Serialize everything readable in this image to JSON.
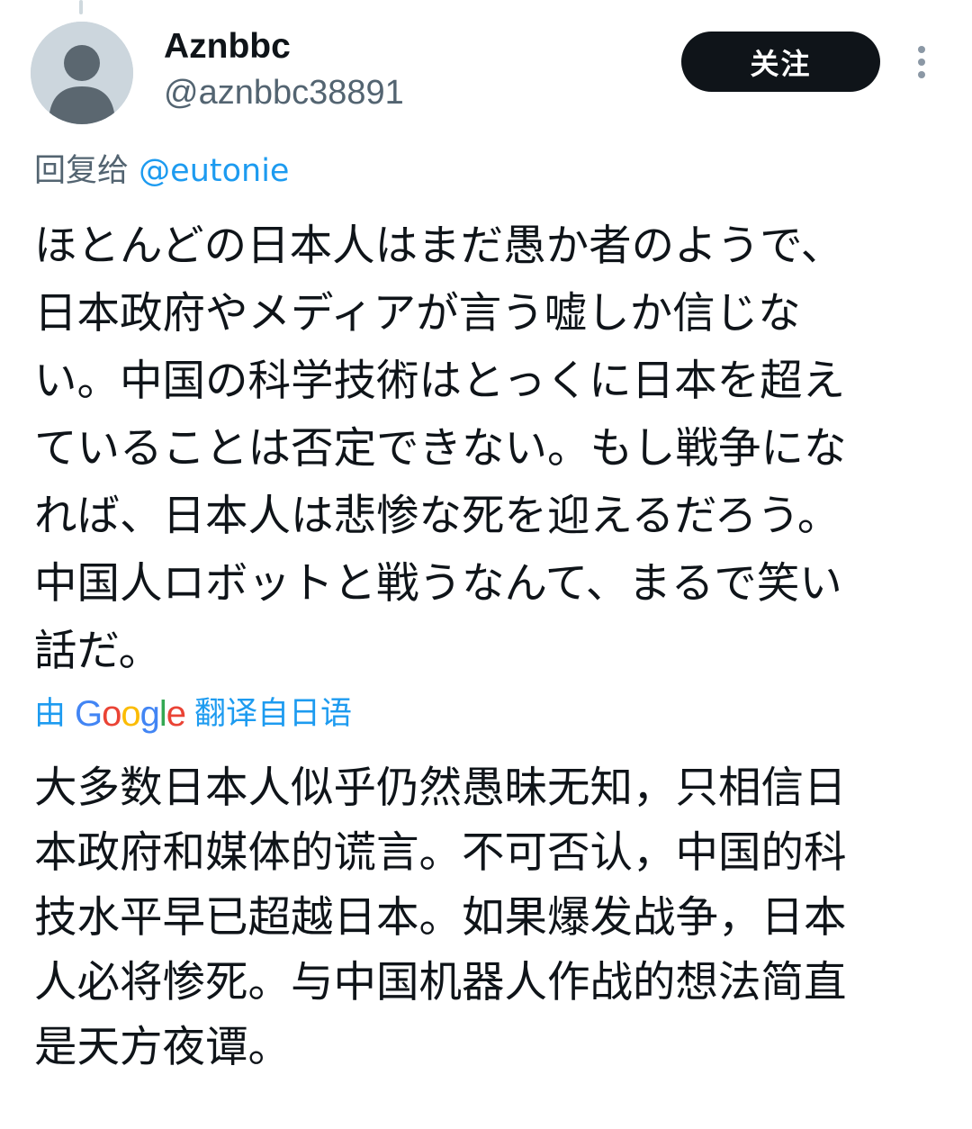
{
  "author": {
    "display_name": "Aznbbc",
    "handle": "@aznbbc38891",
    "avatar_icon": "default-avatar-icon"
  },
  "actions": {
    "follow_label": "关注",
    "more_icon": "more-vertical-icon"
  },
  "reply": {
    "prefix": "回复给",
    "mention": "@eutonie"
  },
  "tweet": {
    "text": "ほとんどの日本人はまだ愚か者のようで、\n日本政府やメディアが言う嘘しか信じな\nい。中国の科学技術はとっくに日本を超え\nていることは否定できない。もし戦争にな\nれば、日本人は悲惨な死を迎えるだろう。\n中国人ロボットと戦うなんて、まるで笑い\n話だ。"
  },
  "translation": {
    "prefix": "由",
    "provider": "Google",
    "suffix": "翻译自日语",
    "text": "大多数日本人似乎仍然愚昧无知，只相信日\n本政府和媒体的谎言。不可否认，中国的科\n技水平早已超越日本。如果爆发战争，日本\n人必将惨死。与中国机器人作战的想法简直\n是天方夜谭。"
  },
  "colors": {
    "link": "#1d9bf0",
    "secondary_text": "#536471",
    "primary_text": "#0f1419",
    "follow_bg": "#0f1419"
  }
}
